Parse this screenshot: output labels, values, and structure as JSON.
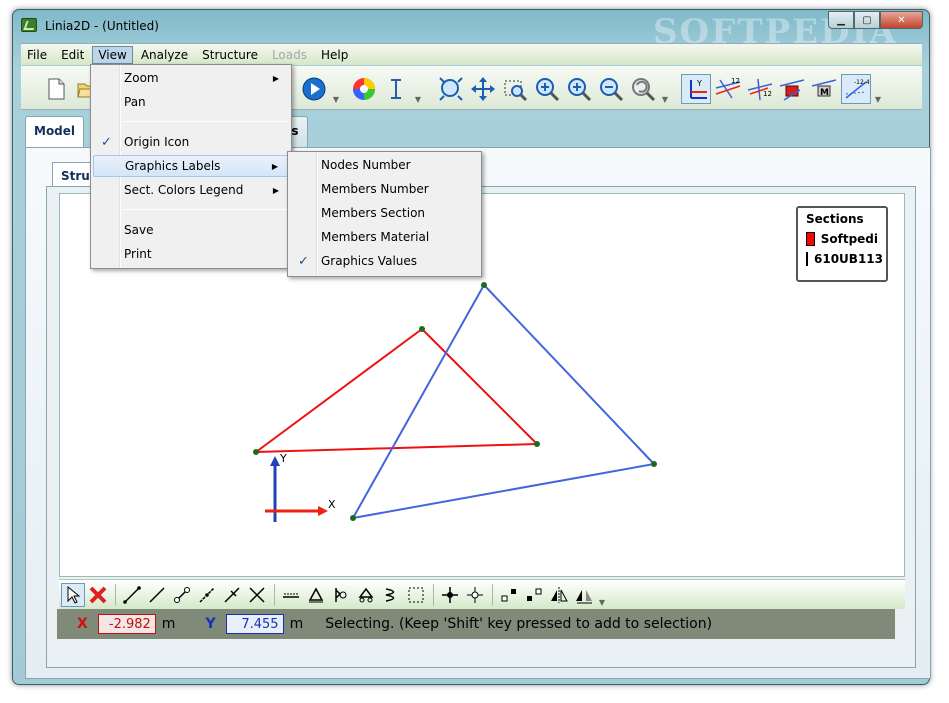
{
  "window": {
    "title": "Linia2D - (Untitled)",
    "watermark": "SOFTPEDIA"
  },
  "menubar": {
    "items": [
      {
        "label": "File"
      },
      {
        "label": "Edit"
      },
      {
        "label": "View"
      },
      {
        "label": "Analyze"
      },
      {
        "label": "Structure"
      },
      {
        "label": "Loads"
      },
      {
        "label": "Help"
      }
    ]
  },
  "tabs": {
    "model": "Model",
    "partial_results": "ults"
  },
  "subtab": {
    "structure": "Structur"
  },
  "view_menu": {
    "zoom": "Zoom",
    "pan": "Pan",
    "origin_icon": "Origin Icon",
    "graphics_labels": "Graphics Labels",
    "sect_colors_legend": "Sect. Colors Legend",
    "save": "Save",
    "print": "Print"
  },
  "graphics_labels_menu": {
    "nodes_number": "Nodes Number",
    "members_number": "Members Number",
    "members_section": "Members Section",
    "members_material": "Members Material",
    "graphics_values": "Graphics Values"
  },
  "legend": {
    "title": "Sections",
    "items": [
      {
        "label": "Softpedi",
        "color": "#ff0000"
      },
      {
        "label": "610UB113",
        "color": "#3a62d8"
      }
    ]
  },
  "axes": {
    "x": "X",
    "y": "Y"
  },
  "status": {
    "x_label": "X",
    "x_value": "-2.982",
    "x_unit": "m",
    "y_label": "Y",
    "y_value": "7.455",
    "y_unit": "m",
    "message": "Selecting. (Keep 'Shift' key pressed to add to selection)"
  },
  "colors": {
    "red_member": "#ee1111",
    "blue_member": "#4466dd",
    "node": "#1c6a1c"
  }
}
